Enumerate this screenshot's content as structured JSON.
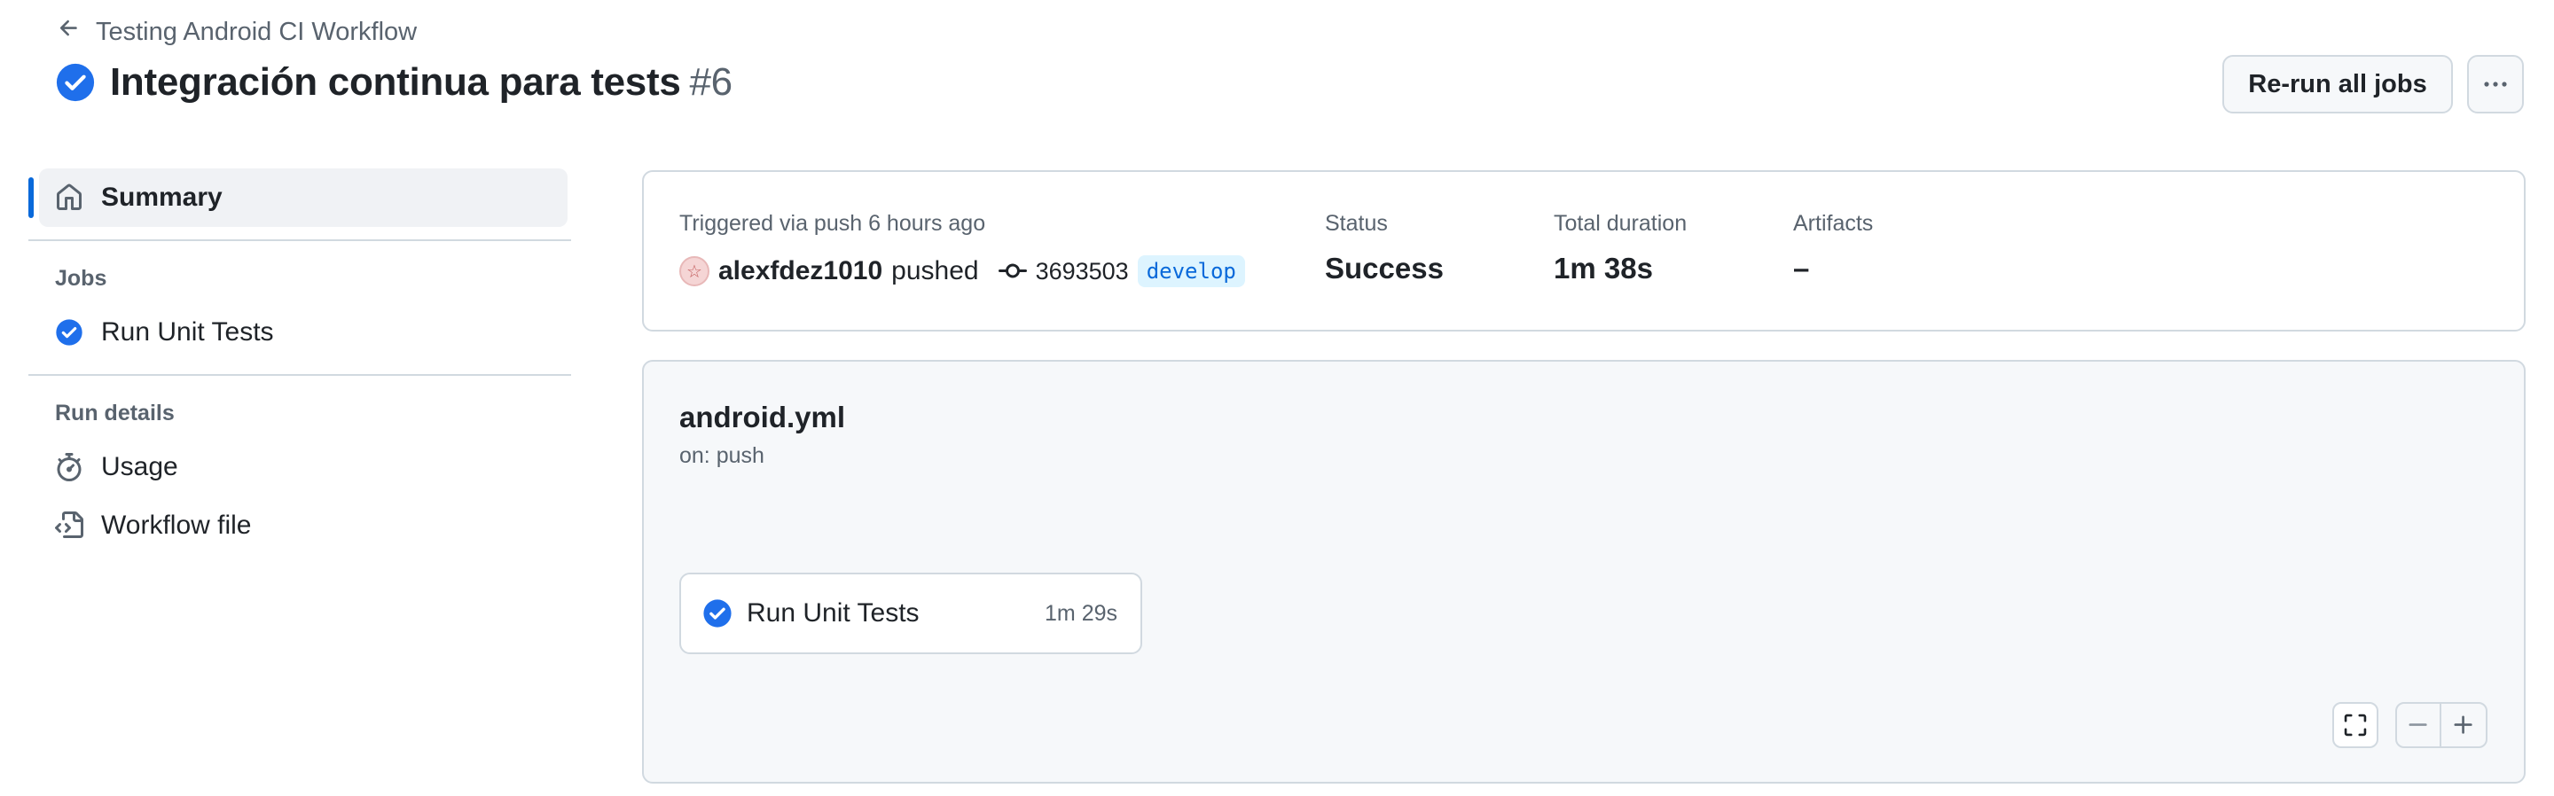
{
  "header": {
    "back_label": "Testing Android CI Workflow",
    "run_title": "Integración continua para tests",
    "run_number": "#6",
    "rerun_label": "Re-run all jobs"
  },
  "sidebar": {
    "summary_label": "Summary",
    "jobs_heading": "Jobs",
    "jobs": [
      {
        "label": "Run Unit Tests"
      }
    ],
    "run_details_heading": "Run details",
    "usage_label": "Usage",
    "workflow_file_label": "Workflow file"
  },
  "summary": {
    "trigger_text": "Triggered via push 6 hours ago",
    "actor": "alexfdez1010",
    "action": "pushed",
    "commit_sha": "3693503",
    "branch": "develop",
    "status_label": "Status",
    "status_value": "Success",
    "duration_label": "Total duration",
    "duration_value": "1m 38s",
    "artifacts_label": "Artifacts",
    "artifacts_value": "–"
  },
  "graph": {
    "workflow_file": "android.yml",
    "trigger": "on: push",
    "jobs": [
      {
        "name": "Run Unit Tests",
        "duration": "1m 29s"
      }
    ]
  },
  "colors": {
    "accent": "#0969da",
    "success_icon": "#1f6feb",
    "border": "#d1d9e0",
    "muted_text": "#59636e",
    "branch_bg": "#ddf4ff"
  },
  "icons": {
    "back": "arrow-left-icon",
    "status": "check-circle-icon",
    "more": "kebab-horizontal-icon",
    "summary": "home-icon",
    "usage": "stopwatch-icon",
    "workflow_file": "file-code-icon",
    "commit": "git-commit-icon",
    "fullscreen": "screen-full-icon",
    "zoom_out": "dash-icon",
    "zoom_in": "plus-icon"
  }
}
